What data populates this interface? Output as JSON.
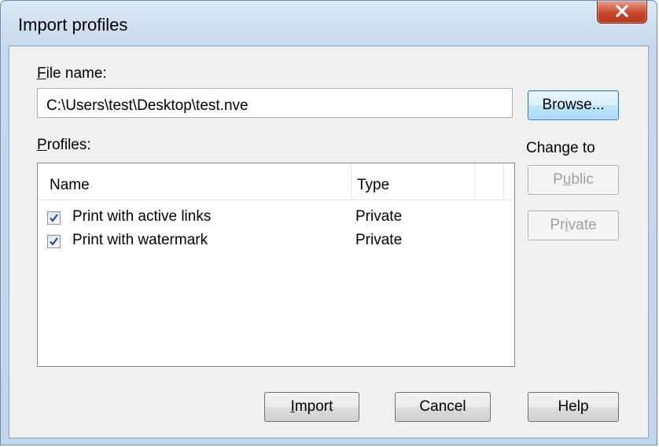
{
  "window": {
    "title": "Import profiles"
  },
  "file": {
    "label_prefix": "",
    "label_mnemonic": "F",
    "label_rest": "ile name:",
    "value": "C:\\Users\\test\\Desktop\\test.nve",
    "browse_label": "Browse..."
  },
  "profiles": {
    "label_mnemonic": "P",
    "label_rest": "rofiles:",
    "columns": [
      "Name",
      "Type"
    ],
    "rows": [
      {
        "name": "Print with active links",
        "type": "Private",
        "checked": true
      },
      {
        "name": "Print with watermark",
        "type": "Private",
        "checked": true
      }
    ]
  },
  "change_to": {
    "label": "Change to",
    "public_pre": "P",
    "public_mnemonic": "u",
    "public_post": "blic",
    "private_pre": "Pr",
    "private_mnemonic": "i",
    "private_post": "vate"
  },
  "buttons": {
    "import_mnemonic": "I",
    "import_rest": "mport",
    "cancel": "Cancel",
    "help": "Help"
  }
}
